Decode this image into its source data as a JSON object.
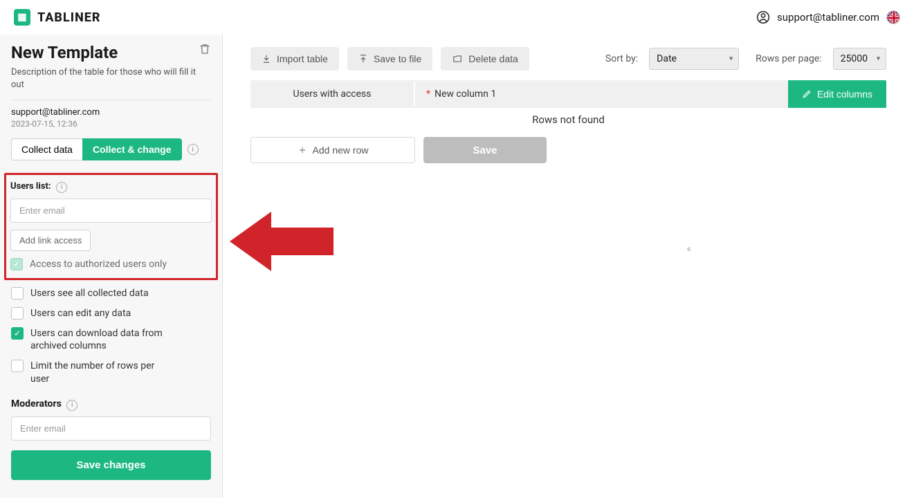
{
  "header": {
    "brand": "TABLINER",
    "user_email": "support@tabliner.com"
  },
  "sidebar": {
    "title": "New Template",
    "description": "Description of the table for those who will fill it out",
    "owner_email": "support@tabliner.com",
    "timestamp": "2023-07-15, 12:36",
    "tab_collect": "Collect data",
    "tab_change": "Collect & change",
    "users_list_label": "Users list:",
    "email_placeholder": "Enter email",
    "add_link_access": "Add link access",
    "chk_authorized": "Access to authorized users only",
    "chk_see_all": "Users see all collected data",
    "chk_edit_any": "Users can edit any data",
    "chk_download": "Users can download data from archived columns",
    "chk_limit": "Limit the number of rows per user",
    "moderators_label": "Moderators",
    "moderator_placeholder": "Enter email",
    "save_changes": "Save changes"
  },
  "toolbar": {
    "import": "Import table",
    "save_file": "Save to file",
    "delete": "Delete data",
    "sort_by_label": "Sort by:",
    "sort_by_value": "Date",
    "rows_label": "Rows per page:",
    "rows_value": "25000"
  },
  "table": {
    "col1": "Users with access",
    "col2": "New column 1",
    "edit_columns": "Edit columns",
    "empty": "Rows not found",
    "add_row": "Add new row",
    "save": "Save"
  }
}
